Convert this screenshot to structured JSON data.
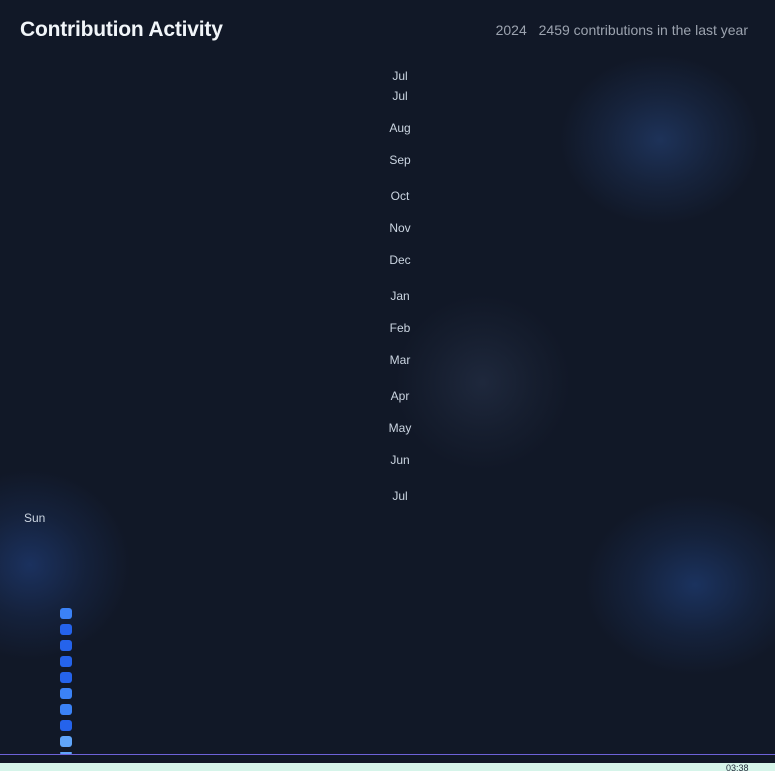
{
  "header": {
    "title": "Contribution Activity",
    "year": "2024",
    "summary": "2459 contributions in the last year"
  },
  "month_labels": [
    "Jul",
    "Jul",
    "Aug",
    "Sep",
    "Oct",
    "Nov",
    "Dec",
    "Jan",
    "Feb",
    "Mar",
    "Apr",
    "May",
    "Jun",
    "Jul"
  ],
  "day_labels": [
    "Sun"
  ],
  "colors": {
    "background": "#111827",
    "level_3": "#60a5fa",
    "level_4": "#3b82f6",
    "level_5": "#2563eb",
    "level_6": "#1d4ed8",
    "taskbar_line": "#6d62d8",
    "taskbar": "#d6f5ea"
  },
  "contribution_cells": [
    {
      "level": 4
    },
    {
      "level": 5
    },
    {
      "level": 5
    },
    {
      "level": 5
    },
    {
      "level": 5
    },
    {
      "level": 4
    },
    {
      "level": 4
    },
    {
      "level": 5
    },
    {
      "level": 3
    },
    {
      "level": 3
    }
  ],
  "taskbar": {
    "clock": "03:38"
  }
}
